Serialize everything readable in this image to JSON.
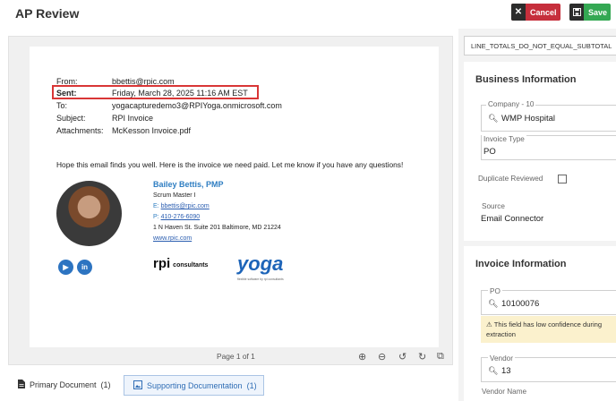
{
  "header": {
    "title": "AP Review",
    "cancel_label": "Cancel",
    "save_label": "Save"
  },
  "email": {
    "from_label": "From:",
    "from_value": "bbettis@rpic.com",
    "sent_label": "Sent:",
    "sent_value": "Friday, March 28, 2025 11:16 AM EST",
    "to_label": "To:",
    "to_value": "yogacapturedemo3@RPIYoga.onmicrosoft.com",
    "subject_label": "Subject:",
    "subject_value": "RPI Invoice",
    "attachments_label": "Attachments:",
    "attachments_value": "McKesson Invoice.pdf",
    "body": "Hope this email finds you well. Here is the invoice we need paid. Let me know if you have any questions!"
  },
  "signature": {
    "name": "Bailey Bettis, PMP",
    "title": "Scrum Master I",
    "email_prefix": "E:",
    "email": "bbettis@rpic.com",
    "phone_prefix": "P:",
    "phone": "410-276-6090",
    "address": "1 N Haven St. Suite 201 Baltimore, MD 21224",
    "website": "www.rpic.com",
    "rpi_logo": "rpi",
    "rpi_logo_sub": "consultants",
    "yoga_logo": "yoga",
    "yoga_tagline": "flexible software by rpi consultants"
  },
  "viewer": {
    "page_label": "Page 1 of 1"
  },
  "tabs": {
    "primary": "Primary Document",
    "primary_count": "(1)",
    "supporting": "Supporting Documentation",
    "supporting_count": "(1)"
  },
  "right_panel": {
    "error_code": "LINE_TOTALS_DO_NOT_EQUAL_SUBTOTAL",
    "business": {
      "title": "Business Information",
      "company_label": "Company - 10",
      "company_value": "WMP Hospital",
      "invoice_type_label": "Invoice Type",
      "invoice_type_value": "PO",
      "duplicate_label": "Duplicate Reviewed",
      "duplicate_checked": false,
      "source_label": "Source",
      "source_value": "Email Connector"
    },
    "invoice": {
      "title": "Invoice Information",
      "po_label": "PO",
      "po_value": "10100076",
      "warning": "This field has low confidence during extraction",
      "vendor_label": "Vendor",
      "vendor_value": "13",
      "vendor_name_label": "Vendor Name"
    }
  },
  "colors": {
    "cancel": "#c62f3c",
    "save": "#34a853",
    "highlight": "#d93636",
    "link": "#2f7ec2",
    "warning_bg": "#fbf1cd"
  }
}
